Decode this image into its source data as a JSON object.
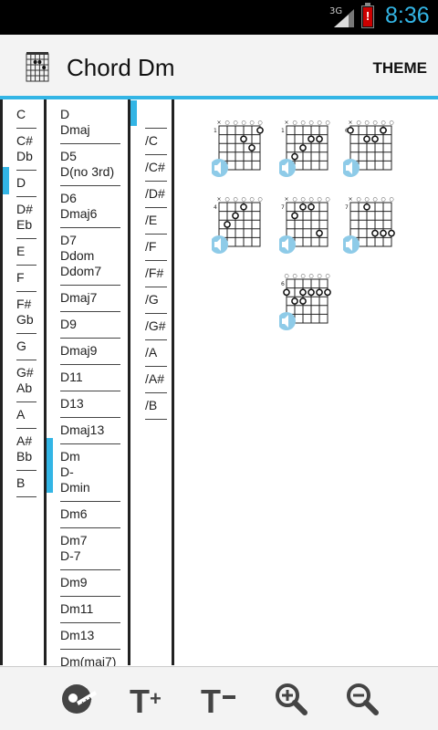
{
  "status_bar": {
    "network": "3G",
    "time": "8:36",
    "battery_alert": "!"
  },
  "action_bar": {
    "title": "Chord Dm",
    "theme_label": "THEME"
  },
  "roots": [
    [
      "C"
    ],
    [
      "C#",
      "Db"
    ],
    [
      "D"
    ],
    [
      "D#",
      "Eb"
    ],
    [
      "E"
    ],
    [
      "F"
    ],
    [
      "F#",
      "Gb"
    ],
    [
      "G"
    ],
    [
      "G#",
      "Ab"
    ],
    [
      "A"
    ],
    [
      "A#",
      "Bb"
    ],
    [
      "B"
    ]
  ],
  "chords": [
    [
      "D",
      "Dmaj"
    ],
    [
      "D5",
      "D(no 3rd)"
    ],
    [
      "D6",
      "Dmaj6"
    ],
    [
      "D7",
      "Ddom",
      "Ddom7"
    ],
    [
      "Dmaj7"
    ],
    [
      "D9"
    ],
    [
      "Dmaj9"
    ],
    [
      "D11"
    ],
    [
      "D13"
    ],
    [
      "Dmaj13"
    ],
    [
      "Dm",
      "D-",
      "Dmin"
    ],
    [
      "Dm6"
    ],
    [
      "Dm7",
      "D-7"
    ],
    [
      "Dm9"
    ],
    [
      "Dm11"
    ],
    [
      "Dm13"
    ],
    [
      "Dm(maj7)"
    ]
  ],
  "bass": [
    "",
    "/C",
    "/C#",
    "/D#",
    "/E",
    "/F",
    "/F#",
    "/G",
    "/G#",
    "/A",
    "/A#",
    "/B"
  ],
  "diagrams": [
    {
      "fret": "1",
      "strings": "×○○○○○",
      "dots": [
        [
          5,
          0
        ],
        [
          3,
          1
        ],
        [
          4,
          2
        ]
      ]
    },
    {
      "fret": "1",
      "strings": "×○○○○○",
      "dots": [
        [
          3,
          1
        ],
        [
          4,
          1
        ],
        [
          2,
          2
        ],
        [
          1,
          3
        ]
      ]
    },
    {
      "fret": "6",
      "strings": "×○○○○○",
      "dots": [
        [
          0,
          0
        ],
        [
          4,
          0
        ],
        [
          2,
          1
        ],
        [
          3,
          1
        ],
        [
          4,
          0
        ]
      ]
    },
    {
      "fret": "4",
      "strings": "×○○○○○",
      "dots": [
        [
          3,
          0
        ],
        [
          2,
          1
        ],
        [
          1,
          2
        ]
      ]
    },
    {
      "fret": "7",
      "strings": "×○○○○○",
      "dots": [
        [
          2,
          0
        ],
        [
          3,
          0
        ],
        [
          1,
          1
        ],
        [
          4,
          3
        ]
      ]
    },
    {
      "fret": "7",
      "strings": "×○○○○○",
      "dots": [
        [
          2,
          0
        ],
        [
          3,
          3
        ],
        [
          4,
          3
        ],
        [
          5,
          3
        ]
      ]
    },
    {
      "fret": "6",
      "strings": "○○○○○○",
      "dots": [
        [
          0,
          1
        ],
        [
          2,
          1
        ],
        [
          3,
          1
        ],
        [
          4,
          1
        ],
        [
          5,
          1
        ],
        [
          1,
          2
        ],
        [
          2,
          2
        ]
      ]
    }
  ],
  "toolbar": {
    "buttons": [
      {
        "name": "guitar-button",
        "label": ""
      },
      {
        "name": "text-larger-button",
        "label": "T+"
      },
      {
        "name": "text-smaller-button",
        "label": "T-"
      },
      {
        "name": "zoom-in-button",
        "label": ""
      },
      {
        "name": "zoom-out-button",
        "label": ""
      }
    ]
  }
}
